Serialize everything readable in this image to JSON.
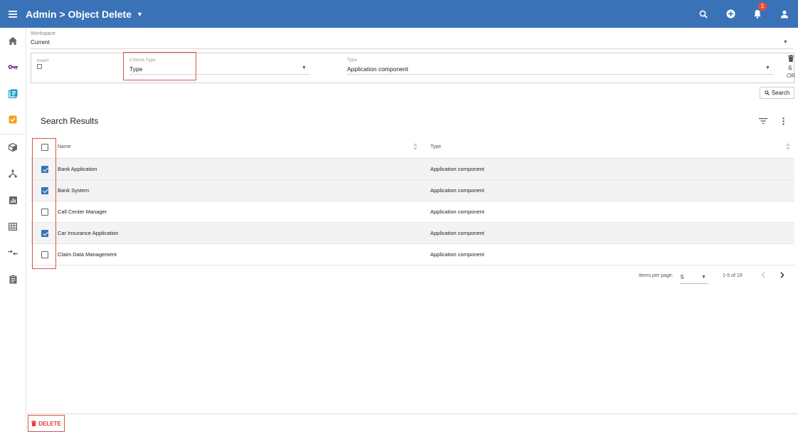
{
  "header": {
    "title": "Admin > Object Delete",
    "notification_count": "1"
  },
  "workspace": {
    "label": "Workspace",
    "value": "Current"
  },
  "criteria": {
    "invert_label": "Invert",
    "criteria_type_label": "Criteria Type",
    "criteria_type_value": "Type",
    "type_label": "Type",
    "type_value": "Application component",
    "amp": "&",
    "or": "OR"
  },
  "search_button": "Search",
  "results": {
    "title": "Search Results",
    "columns": [
      "Name",
      "Type"
    ],
    "rows": [
      {
        "name": "Bank Application",
        "type": "Application component",
        "checked": true
      },
      {
        "name": "Bank System",
        "type": "Application component",
        "checked": true
      },
      {
        "name": "Call Center Manager",
        "type": "Application component",
        "checked": false
      },
      {
        "name": "Car Insurance Application",
        "type": "Application component",
        "checked": true
      },
      {
        "name": "Claim Data Management",
        "type": "Application component",
        "checked": false
      }
    ]
  },
  "pagination": {
    "items_per_page_label": "Items per page:",
    "items_per_page_value": "5",
    "range": "1-5 of 19"
  },
  "footer": {
    "delete_label": "DELETE"
  },
  "colors": {
    "primary": "#3a72b8",
    "accent_red": "#e53935",
    "highlight_frame": "#d9534f"
  }
}
